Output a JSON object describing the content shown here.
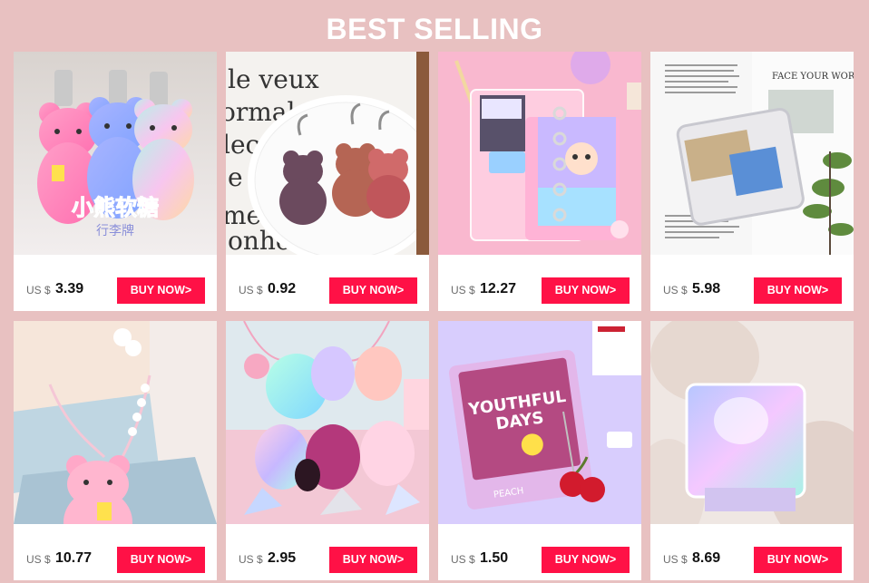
{
  "section": {
    "title": "BEST SELLING"
  },
  "products": [
    {
      "currency": "US $",
      "price": "3.39",
      "buy_label": "BUY NOW>",
      "image_text": [
        "小熊软糖",
        "行李牌"
      ]
    },
    {
      "currency": "US $",
      "price": "0.92",
      "buy_label": "BUY NOW>",
      "image_text": [
        "le veux",
        "ormal",
        "lect",
        "e",
        "mer",
        "onheu"
      ]
    },
    {
      "currency": "US $",
      "price": "12.27",
      "buy_label": "BUY NOW>"
    },
    {
      "currency": "US $",
      "price": "5.98",
      "buy_label": "BUY NOW>",
      "image_text": [
        "FACE YOUR WORLD"
      ]
    },
    {
      "currency": "US $",
      "price": "10.77",
      "buy_label": "BUY NOW>"
    },
    {
      "currency": "US $",
      "price": "2.95",
      "buy_label": "BUY NOW>"
    },
    {
      "currency": "US $",
      "price": "1.50",
      "buy_label": "BUY NOW>",
      "image_text": [
        "YOUTHFUL",
        "DAYS",
        "PEACH"
      ]
    },
    {
      "currency": "US $",
      "price": "8.69",
      "buy_label": "BUY NOW>"
    }
  ],
  "colors": {
    "background": "#e8c1c1",
    "buy_button": "#ff1146",
    "card": "#ffffff"
  }
}
